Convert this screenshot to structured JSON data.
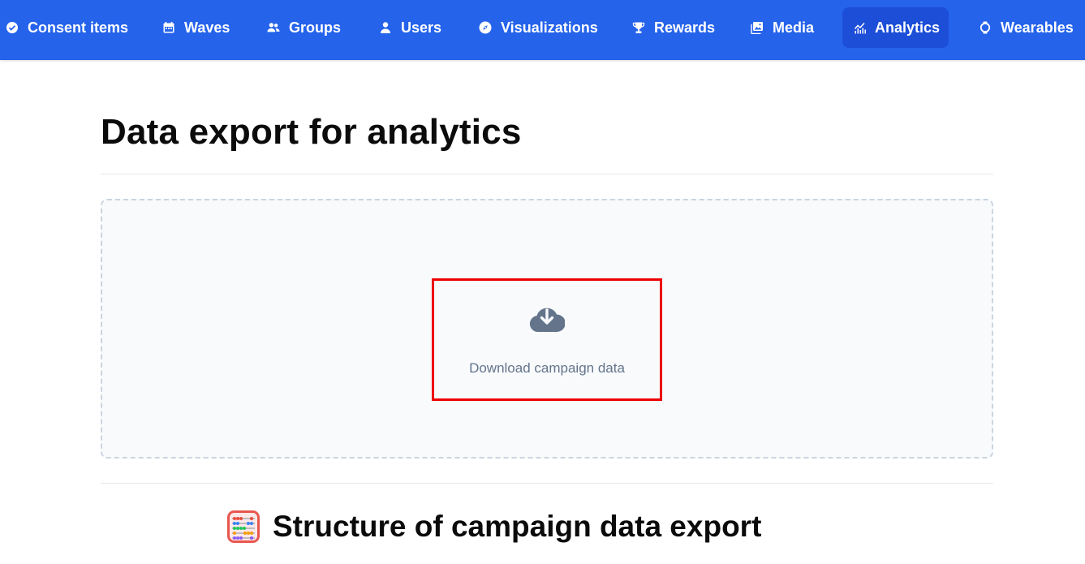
{
  "nav": {
    "items": [
      {
        "label": "Consent items",
        "icon": "check-circle-icon"
      },
      {
        "label": "Waves",
        "icon": "calendar-icon"
      },
      {
        "label": "Groups",
        "icon": "users-icon"
      },
      {
        "label": "Users",
        "icon": "user-icon"
      },
      {
        "label": "Visualizations",
        "icon": "compass-icon"
      },
      {
        "label": "Rewards",
        "icon": "trophy-icon"
      },
      {
        "label": "Media",
        "icon": "image-icon"
      },
      {
        "label": "Analytics",
        "icon": "chart-icon",
        "active": true
      },
      {
        "label": "Wearables",
        "icon": "watch-icon"
      }
    ],
    "bg_color": "#2563eb",
    "active_color": "#1d4ed8"
  },
  "page": {
    "title": "Data export for analytics"
  },
  "export": {
    "button_label": "Download campaign data",
    "icon": "cloud-download-icon",
    "highlight_color": "#ee0000"
  },
  "structure": {
    "heading": "Structure of campaign data export",
    "icon": "abacus-icon"
  }
}
